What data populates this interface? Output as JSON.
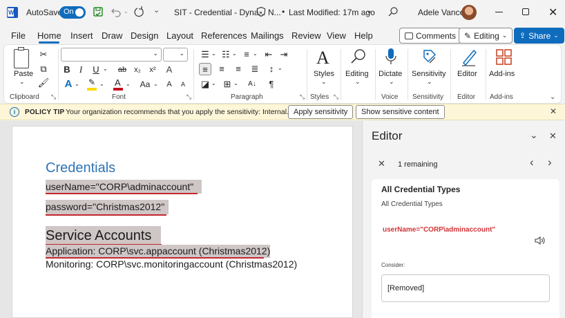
{
  "titlebar": {
    "autosave_label": "AutoSave",
    "toggle_label": "On",
    "doc_title": "SIT - Credential - Dyna...",
    "sensitivity_short": "N...",
    "last_modified": "Last Modified: 17m ago",
    "user_name": "Adele Vance"
  },
  "menu": {
    "items": [
      "File",
      "Home",
      "Insert",
      "Draw",
      "Design",
      "Layout",
      "References",
      "Mailings",
      "Review",
      "View",
      "Help"
    ],
    "active": "Home",
    "comments_label": "Comments",
    "editing_label": "Editing",
    "share_label": "Share"
  },
  "ribbon": {
    "paste_label": "Paste",
    "styles_label": "Styles",
    "editing_label": "Editing",
    "dictate_label": "Dictate",
    "sensitivity_label": "Sensitivity",
    "editor_label": "Editor",
    "addins_label": "Add-ins",
    "groups": {
      "clipboard": "Clipboard",
      "font": "Font",
      "paragraph": "Paragraph",
      "styles": "Styles",
      "voice": "Voice",
      "sensitivity": "Sensitivity",
      "editor": "Editor",
      "addins": "Add-ins"
    },
    "font_icons": {
      "bold": "B",
      "italic": "I",
      "underline": "U",
      "strike": "ab",
      "subscript": "x₂",
      "superscript": "x²",
      "clear_format": "A",
      "text_effects": "A",
      "highlight": "ab",
      "font_color": "A",
      "change_case": "Aa"
    }
  },
  "policy": {
    "title": "POLICY TIP",
    "message": "Your organization recommends that you apply the sensitivity: Internal.",
    "apply_button": "Apply sensitivity",
    "show_button": "Show sensitive content"
  },
  "document": {
    "heading1": "Credentials",
    "line_username": "userName=\"CORP\\adminaccount\"",
    "line_password": "password=\"Christmas2012\"",
    "heading2": "Service Accounts",
    "line_application": "Application:  CORP\\svc.appaccount (Christmas2012)",
    "line_monitoring": "Monitoring:  CORP\\svc.monitoringaccount (Christmas2012)"
  },
  "editor_pane": {
    "title": "Editor",
    "remaining": "1 remaining",
    "card_title": "All Credential Types",
    "card_subtitle": "All Credential Types",
    "flagged_text": "userName=\"CORP\\adminaccount\"",
    "consider_label": "Consider:",
    "suggestion": "[Removed]"
  },
  "colors": {
    "accent": "#0f6cbd",
    "flagged": "#d13438",
    "policy_bar": "#fdf6d8",
    "heading_blue": "#2e74b5"
  }
}
